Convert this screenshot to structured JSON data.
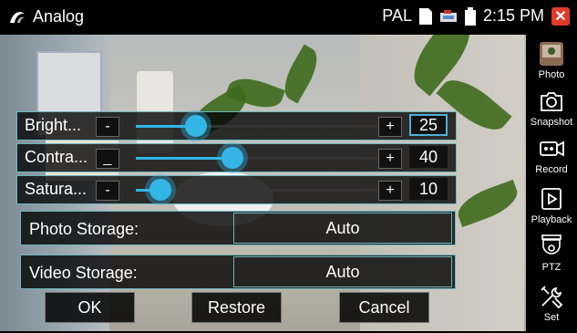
{
  "status_bar": {
    "app_title": "Analog",
    "video_standard": "PAL",
    "time": "2:15 PM",
    "app_icon": "water-wave-icon",
    "close_icon": "close-icon"
  },
  "settings": {
    "sliders": [
      {
        "label": "Bright...",
        "value": "25",
        "minus": "-",
        "plus": "+",
        "level": 25,
        "active": true
      },
      {
        "label": "Contra...",
        "value": "40",
        "minus": "_",
        "plus": "+",
        "level": 40,
        "active": false
      },
      {
        "label": "Satura...",
        "value": "10",
        "minus": "-",
        "plus": "+",
        "level": 10,
        "active": false
      }
    ],
    "photo_storage": {
      "label": "Photo Storage:",
      "value": "Auto"
    },
    "video_storage": {
      "label": "Video Storage:",
      "value": "Auto"
    },
    "buttons": {
      "ok": "OK",
      "restore": "Restore",
      "cancel": "Cancel"
    }
  },
  "side_menu": [
    {
      "label": "Photo",
      "icon": "photo-thumbnail-icon"
    },
    {
      "label": "Snapshot",
      "icon": "camera-icon"
    },
    {
      "label": "Record",
      "icon": "video-camera-icon"
    },
    {
      "label": "Playback",
      "icon": "play-icon"
    },
    {
      "label": "PTZ",
      "icon": "dome-camera-icon"
    },
    {
      "label": "Set",
      "icon": "tools-icon"
    }
  ],
  "colors": {
    "accent": "#33b5e5",
    "border": "#6fb7be",
    "close": "#e23a2a"
  }
}
